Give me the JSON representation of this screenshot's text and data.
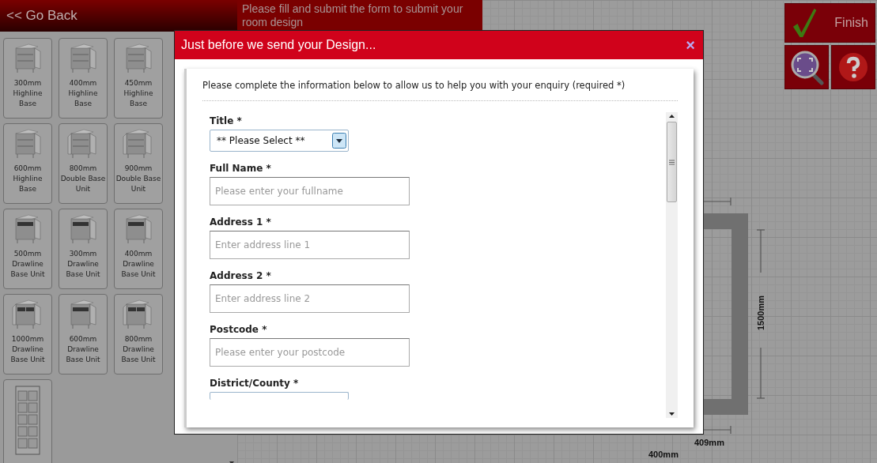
{
  "header": {
    "back_link": "<< Go Back",
    "message": "Please fill and submit the form to submit your room design"
  },
  "products": [
    {
      "label": "300mm Highline Base",
      "kind": "single"
    },
    {
      "label": "400mm Highline Base",
      "kind": "single"
    },
    {
      "label": "450mm Highline Base",
      "kind": "single"
    },
    {
      "label": "600mm Highline Base",
      "kind": "single"
    },
    {
      "label": "800mm Double Base Unit",
      "kind": "double"
    },
    {
      "label": "900mm Double Base Unit",
      "kind": "double"
    },
    {
      "label": "500mm Drawline Base Unit",
      "kind": "drawer"
    },
    {
      "label": "300mm Drawline Base Unit",
      "kind": "drawer"
    },
    {
      "label": "400mm Drawline Base Unit",
      "kind": "drawer"
    },
    {
      "label": "1000mm Drawline Base Unit",
      "kind": "double-drawer"
    },
    {
      "label": "600mm Drawline Base Unit",
      "kind": "drawer"
    },
    {
      "label": "800mm Drawline Base Unit",
      "kind": "double-drawer"
    },
    {
      "kind": "tall"
    }
  ],
  "toolbar": {
    "finish": "Finish"
  },
  "plan": {
    "height_label": "1500mm",
    "width_label": "409mm",
    "bottom_label": "400mm"
  },
  "dialog": {
    "title": "Just before we send your Design...",
    "close": "×",
    "intro": "Please complete the information below to allow us to help you with your enquiry (required *)",
    "fields": [
      {
        "kind": "select",
        "label": "Title *",
        "value": "** Please Select **"
      },
      {
        "kind": "text",
        "label": "Full Name *",
        "placeholder": "Please enter your fullname"
      },
      {
        "kind": "text",
        "label": "Address 1 *",
        "placeholder": "Enter address line 1"
      },
      {
        "kind": "text",
        "label": "Address 2 *",
        "placeholder": "Enter address line 2"
      },
      {
        "kind": "text",
        "label": "Postcode *",
        "placeholder": "Please enter your postcode"
      },
      {
        "kind": "select",
        "label": "District/County *"
      }
    ]
  }
}
